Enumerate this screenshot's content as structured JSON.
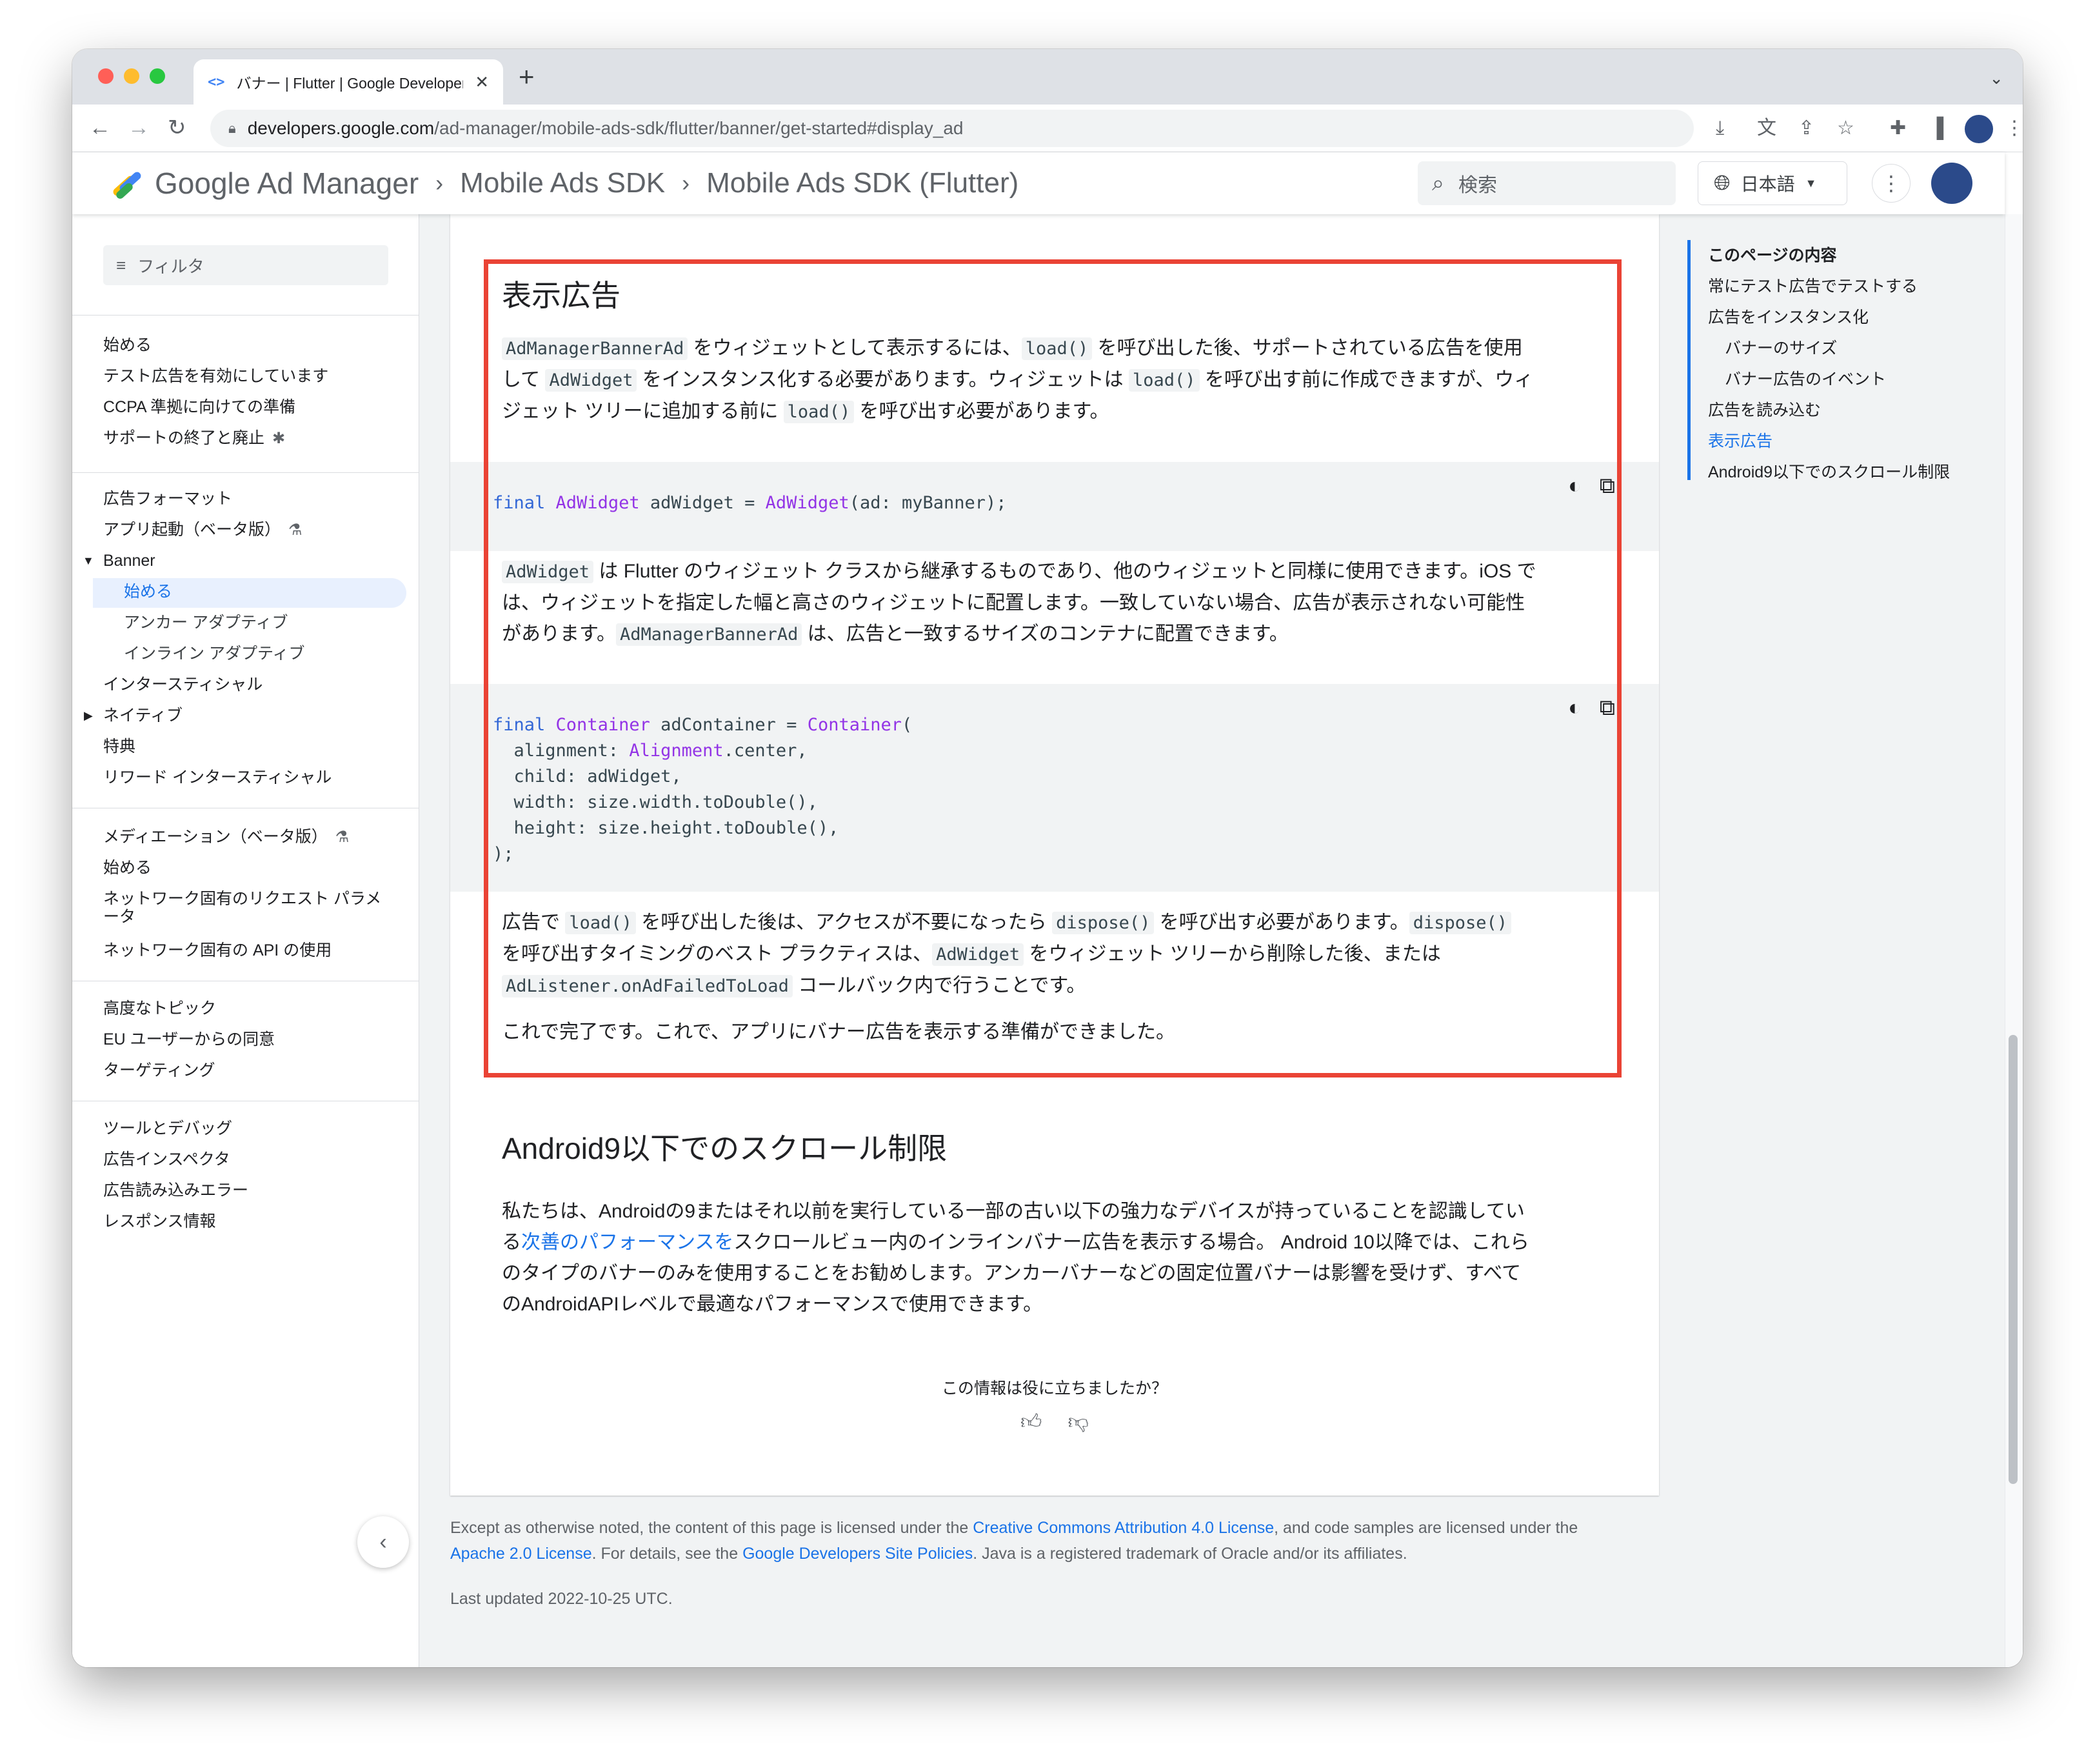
{
  "browser": {
    "tab_title": "バナー | Flutter | Google Developers",
    "tab_favicon": "<>",
    "url_domain": "developers.google.com",
    "url_path": "/ad-manager/mobile-ads-sdk/flutter/banner/get-started#display_ad"
  },
  "header": {
    "brand": "Google Ad Manager",
    "breadcrumbs": [
      "Mobile Ads SDK",
      "Mobile Ads SDK (Flutter)"
    ],
    "search_placeholder": "検索",
    "language": "日本語"
  },
  "sidebar": {
    "filter_placeholder": "フィルタ",
    "group1": [
      "始める",
      "テスト広告を有効にしています",
      "CCPA 準拠に向けての準備",
      "サポートの終了と廃止"
    ],
    "group2": {
      "heading": "広告フォーマット",
      "app_open": "アプリ起動（ベータ版）",
      "banner": "Banner",
      "banner_children": [
        "始める",
        "アンカー アダプティブ",
        "インライン アダプティブ"
      ],
      "rest": [
        "インタースティシャル",
        "ネイティブ",
        "特典",
        "リワード インタースティシャル"
      ]
    },
    "group3": {
      "heading": "メディエーション（ベータ版）",
      "items": [
        "始める",
        "ネットワーク固有のリクエスト パラメ",
        "ータ",
        "ネットワーク固有の API の使用"
      ]
    },
    "group4": {
      "heading": "高度なトピック",
      "items": [
        "EU ユーザーからの同意",
        "ターゲティング"
      ]
    },
    "group5": {
      "heading": "ツールとデバッグ",
      "items": [
        "広告インスペクタ",
        "広告読み込みエラー",
        "レスポンス情報"
      ]
    }
  },
  "content": {
    "section1_title": "表示広告",
    "p1": {
      "c1": "AdManagerBannerAd",
      "t1": " をウィジェットとして表示するには、",
      "c2": "load()",
      "t2": " を呼び出した後、サポートされている広告を使用",
      "t3": "して ",
      "c3": "AdWidget",
      "t4": " をインスタンス化する必要があります。ウィジェットは ",
      "c4": "load()",
      "t5": " を呼び出す前に作成できますが、ウィ",
      "t6": "ジェット ツリーに追加する前に ",
      "c5": "load()",
      "t7": " を呼び出す必要があります。"
    },
    "code1": {
      "kw": "final",
      "type1": "AdWidget",
      "mid": " adWidget = ",
      "type2": "AdWidget",
      "rest": "(ad: myBanner);"
    },
    "p2": {
      "c1": "AdWidget",
      "t1": " は Flutter のウィジェット クラスから継承するものであり、他のウィジェットと同様に使用できます。iOS で",
      "t2": "は、ウィジェットを指定した幅と高さのウィジェットに配置します。一致していない場合、広告が表示されない可能性",
      "t3": "があります。",
      "c2": "AdManagerBannerAd",
      "t4": " は、広告と一致するサイズのコンテナに配置できます。"
    },
    "code2": {
      "l1_kw": "final",
      "l1_type1": "Container",
      "l1_mid": " adContainer = ",
      "l1_type2": "Container",
      "l1_end": "(",
      "l2_a": "  alignment: ",
      "l2_type": "Alignment",
      "l2_b": ".center,",
      "l3": "  child: adWidget,",
      "l4": "  width: size.width.toDouble(),",
      "l5": "  height: size.height.toDouble(),",
      "l6": ");"
    },
    "p3": {
      "t1": "広告で ",
      "c1": "load()",
      "t2": " を呼び出した後は、アクセスが不要になったら ",
      "c2": "dispose()",
      "t3": " を呼び出す必要があります。",
      "c3": "dispose()",
      "t4": "を呼び出すタイミングのベスト プラクティスは、",
      "c4": "AdWidget",
      "t5": " をウィジェット ツリーから削除した後、または",
      "c5": "AdListener.onAdFailedToLoad",
      "t6": " コールバック内で行うことです。"
    },
    "p4": "これで完了です。これで、アプリにバナー広告を表示する準備ができました。",
    "section2_title": "Android9以下でのスクロール制限",
    "p5": {
      "l1": "私たちは、Androidの9またはそれ以前を実行している一部の古い以下の強力なデバイスが持っていることを認識してい",
      "l2a": "る",
      "l2link": "次善のパフォーマンスを",
      "l2b": "スクロールビュー内のインラインバナー広告を表示する場合。 Android 10以降では、これら",
      "l3": "のタイプのバナーのみを使用することをお勧めします。アンカーバナーなどの固定位置バナーは影響を受けず、すべて",
      "l4": "のAndroidAPIレベルで最適なパフォーマンスで使用できます。"
    },
    "feedback": "この情報は役に立ちましたか？"
  },
  "footer": {
    "t1": "Except as otherwise noted, the content of this page is licensed under the ",
    "l1": "Creative Commons Attribution 4.0 License",
    "t2": ", and code samples are licensed under the",
    "l2": "Apache 2.0 License",
    "t3": ". For details, see the ",
    "l3": "Google Developers Site Policies",
    "t4": ". Java is a registered trademark of Oracle and/or its affiliates.",
    "updated": "Last updated 2022-10-25 UTC."
  },
  "toc": {
    "heading": "このページの内容",
    "items": [
      "常にテスト広告でテストする",
      "広告をインスタンス化",
      "バナーのサイズ",
      "バナー広告のイベント",
      "広告を読み込む",
      "表示広告",
      "Android9以下でのスクロール制限"
    ]
  },
  "colors": {
    "accent": "#1a73e8",
    "highlight_box": "#ea4335",
    "code_bg": "#f1f3f4"
  },
  "icons": [
    "back-icon",
    "forward-icon",
    "reload-icon",
    "lock-icon",
    "search-icon",
    "globe-icon",
    "theme-toggle-icon",
    "copy-icon",
    "thumb-up-icon",
    "thumb-down-icon",
    "filter-icon",
    "chevron-left-icon"
  ]
}
